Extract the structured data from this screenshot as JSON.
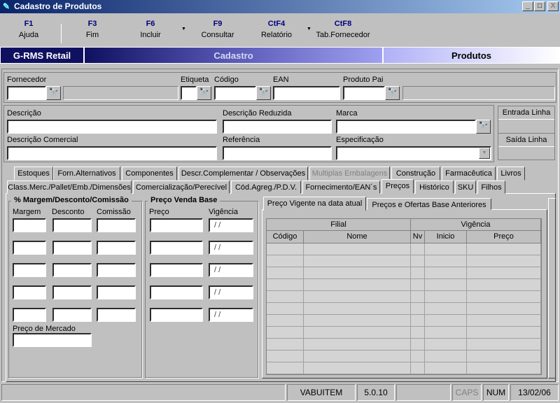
{
  "window": {
    "title": "Cadastro de Produtos",
    "controls": [
      "_",
      "□",
      "X"
    ]
  },
  "toolbar": [
    {
      "key": "F1",
      "label": "Ajuda"
    },
    {
      "key": "F3",
      "label": "Fim"
    },
    {
      "key": "F6",
      "label": "Incluir"
    },
    {
      "key": "F9",
      "label": "Consultar"
    },
    {
      "key": "CtF4",
      "label": "Relatório"
    },
    {
      "key": "CtF8",
      "label": "Tab.Fornecedor"
    }
  ],
  "banner": {
    "app": "G-RMS Retail",
    "module": "Cadastro",
    "screen": "Produtos"
  },
  "fields": {
    "fornecedor": "Fornecedor",
    "etiqueta": "Etiqueta",
    "codigo": "Código",
    "ean": "EAN",
    "produto_pai": "Produto Pai",
    "descricao": "Descrição",
    "descricao_reduzida": "Descrição Reduzida",
    "marca": "Marca",
    "descricao_comercial": "Descrição Comercial",
    "referencia": "Referência",
    "especificacao": "Especificação"
  },
  "side_box": {
    "entrada": "Entrada Linha",
    "saida": "Saída Linha"
  },
  "tabs_row1": [
    "Estoques",
    "Forn.Alternativos",
    "Componentes",
    "Descr.Complementar / Observações",
    "Multiplas Embalagens",
    "Construção",
    "Farmacêutica",
    "Livros"
  ],
  "tabs_row2": [
    "Class.Merc./Pallet/Emb./Dimensões",
    "Comercialização/Perecível",
    "Cód.Agreg./P.D.V.",
    "Fornecimento/EAN´s",
    "Preços",
    "Histórico",
    "SKU",
    "Filhos"
  ],
  "active_tab": "Preços",
  "margem_group": {
    "title": "% Margem/Desconto/Comissão",
    "cols": [
      "Margem",
      "Desconto",
      "Comissão"
    ],
    "preco_mercado": "Preço de Mercado"
  },
  "preco_group": {
    "title": "Preço Venda Base",
    "cols": [
      "Preço",
      "Vigência"
    ],
    "date_placeholder": " / /"
  },
  "inner_tabs": [
    "Preço Vigente na data atual",
    "Preços e Ofertas Base Anteriores"
  ],
  "grid": {
    "groups": [
      "Filial",
      "Vigência"
    ],
    "columns": [
      "Código",
      "Nome",
      "Nv",
      "Inicio",
      "Preço"
    ]
  },
  "status": [
    "",
    "VABUITEM",
    "5.0.10",
    "",
    "CAPS",
    "NUM",
    "13/02/06"
  ]
}
